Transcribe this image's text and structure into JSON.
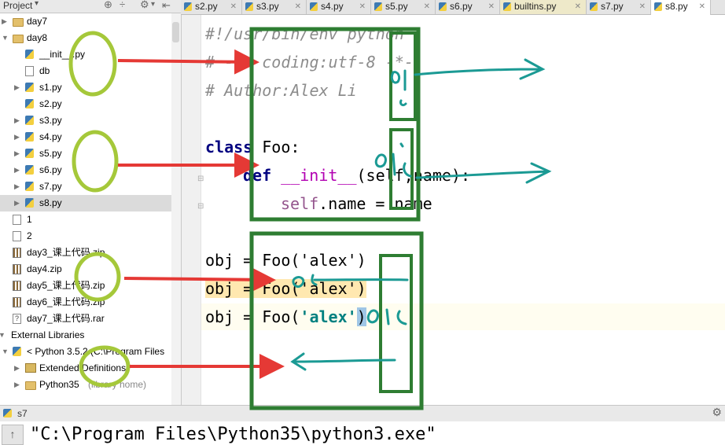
{
  "project_pane": {
    "title": "Project",
    "tree": [
      {
        "label": "day7",
        "icon": "folder-icon",
        "arrow": "collapsed",
        "indent": 0
      },
      {
        "label": "day8",
        "icon": "folder-icon",
        "arrow": "expanded",
        "indent": 0
      },
      {
        "label": "__init__.py",
        "icon": "python-file-icon",
        "arrow": "",
        "indent": 1
      },
      {
        "label": "db",
        "icon": "text-file-icon",
        "arrow": "",
        "indent": 1
      },
      {
        "label": "s1.py",
        "icon": "python-file-icon",
        "arrow": "collapsed",
        "indent": 1
      },
      {
        "label": "s2.py",
        "icon": "python-file-icon",
        "arrow": "",
        "indent": 1
      },
      {
        "label": "s3.py",
        "icon": "python-file-icon",
        "arrow": "collapsed",
        "indent": 1
      },
      {
        "label": "s4.py",
        "icon": "python-file-icon",
        "arrow": "collapsed",
        "indent": 1
      },
      {
        "label": "s5.py",
        "icon": "python-file-icon",
        "arrow": "collapsed",
        "indent": 1
      },
      {
        "label": "s6.py",
        "icon": "python-file-icon",
        "arrow": "collapsed",
        "indent": 1
      },
      {
        "label": "s7.py",
        "icon": "python-file-icon",
        "arrow": "collapsed",
        "indent": 1
      },
      {
        "label": "s8.py",
        "icon": "python-file-icon",
        "arrow": "collapsed",
        "indent": 1,
        "selected": true
      },
      {
        "label": "1",
        "icon": "text-file-icon",
        "arrow": "",
        "indent": 0
      },
      {
        "label": "2",
        "icon": "text-file-icon",
        "arrow": "",
        "indent": 0
      },
      {
        "label": "day3_课上代码.zip",
        "icon": "zip-file-icon",
        "arrow": "",
        "indent": 0
      },
      {
        "label": "day4.zip",
        "icon": "zip-file-icon",
        "arrow": "",
        "indent": 0
      },
      {
        "label": "day5_课上代码.zip",
        "icon": "zip-file-icon",
        "arrow": "",
        "indent": 0
      },
      {
        "label": "day6_课上代码.zip",
        "icon": "zip-file-icon",
        "arrow": "",
        "indent": 0
      },
      {
        "label": "day7_课上代码.rar",
        "icon": "unknown-file-icon",
        "arrow": "",
        "indent": 0
      },
      {
        "label": "External Libraries",
        "icon": "library-icon",
        "arrow": "expanded",
        "indent": -1
      },
      {
        "label": "< Python 3.5.2 (C:\\Program Files",
        "icon": "python-sdk-icon",
        "arrow": "expanded",
        "indent": 0
      },
      {
        "label": "Extended Definitions",
        "icon": "library-icon",
        "arrow": "collapsed",
        "indent": 1
      },
      {
        "label": "Python35",
        "suffix": "(library home)",
        "icon": "folder-icon",
        "arrow": "collapsed",
        "indent": 1
      }
    ]
  },
  "tabs": [
    {
      "label": "s2.py"
    },
    {
      "label": "s3.py"
    },
    {
      "label": "s4.py"
    },
    {
      "label": "s5.py"
    },
    {
      "label": "s6.py"
    },
    {
      "label": "builtins.py",
      "special": true
    },
    {
      "label": "s7.py"
    },
    {
      "label": "s8.py",
      "active": true
    }
  ],
  "editor": {
    "lines": {
      "shebang": "#!/usr/bin/env python",
      "coding": "# -*- coding:utf-8 -*-",
      "author": "# Author:Alex Li",
      "class_kw": "class",
      "class_name": " Foo:",
      "def_kw": "def",
      "init": "__init__",
      "params": "(self,name):",
      "self": "self",
      "assign": ".name = name",
      "obj1": "obj = Foo('alex')",
      "obj2": "obj = Foo('alex')",
      "obj3_a": "obj = Foo(",
      "obj3_str": "'alex'",
      "obj3_b": ")"
    }
  },
  "run_panel": {
    "title": "s7",
    "command": "\"C:\\Program Files\\Python35\\python3.exe\""
  },
  "annotations": {
    "handwritten": [
      "0x5",
      "0x5",
      "0x5",
      "0x5"
    ],
    "colors": {
      "circle": "#a5c83a",
      "box": "#2e7d32",
      "arrow_red": "#e53935",
      "ink": "#1b9a94"
    }
  }
}
